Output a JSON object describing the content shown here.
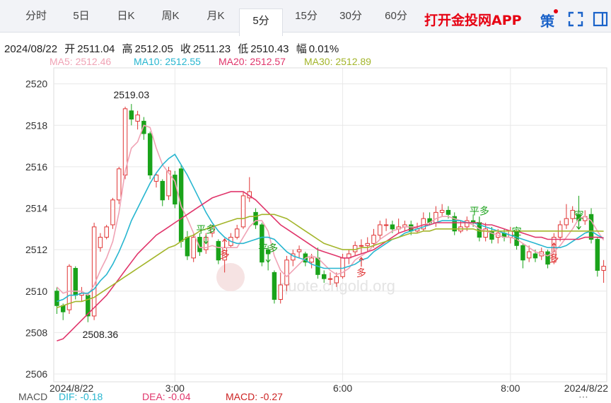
{
  "tabs": [
    {
      "label": "分时",
      "active": false
    },
    {
      "label": "5日",
      "active": false
    },
    {
      "label": "日K",
      "active": false
    },
    {
      "label": "周K",
      "active": false
    },
    {
      "label": "月K",
      "active": false
    },
    {
      "label": "5分",
      "active": true
    },
    {
      "label": "15分",
      "active": false
    },
    {
      "label": "30分",
      "active": false
    },
    {
      "label": "60分",
      "active": false
    }
  ],
  "app_link": "打开金投网APP",
  "strategy_label": "策",
  "icons": {
    "fullscreen": "fullscreen-icon",
    "panel": "panel-icon"
  },
  "quote": {
    "date": "2024/08/22",
    "open_label": "开",
    "open": "2511.04",
    "high_label": "高",
    "high": "2512.05",
    "close_label": "收",
    "close": "2511.23",
    "low_label": "低",
    "low": "2510.43",
    "amp_label": "幅",
    "amp": "0.01%"
  },
  "ma": [
    {
      "text": "MA5: 2512.46",
      "color": "#f0a3b5"
    },
    {
      "text": "MA10: 2512.55",
      "color": "#27b6d0"
    },
    {
      "text": "MA20: 2512.57",
      "color": "#e0356b"
    },
    {
      "text": "MA30: 2512.89",
      "color": "#a3b52a"
    }
  ],
  "macd": {
    "label": "MACD",
    "dif": "DIF: -0.18",
    "dif_color": "#27b6d0",
    "dea": "DEA: -0.04",
    "dea_color": "#e0356b",
    "macd": "MACD: -0.27",
    "macd_color": "#cc2222"
  },
  "watermark": "quote.cngold.org",
  "colors": {
    "up": "#e03535",
    "down": "#1aa31a",
    "grid": "#e8e8e8"
  },
  "chart_data": {
    "type": "candlestick",
    "ylim": [
      2506,
      2520.5
    ],
    "yticks": [
      2506,
      2508,
      2510,
      2512,
      2514,
      2516,
      2518,
      2520
    ],
    "xticks": [
      {
        "label": "2024/8/22",
        "index": 0
      },
      {
        "label": "3:00",
        "index": 19
      },
      {
        "label": "6:00",
        "index": 46
      },
      {
        "label": "8:00",
        "index": 73
      },
      {
        "label": "2024/8/22",
        "index": 88
      }
    ],
    "annotations": [
      {
        "text": "2519.03",
        "index": 12,
        "value": 2519.03,
        "pos": "above"
      },
      {
        "text": "2508.36",
        "index": 7,
        "value": 2508.36,
        "pos": "below"
      }
    ],
    "signals": [
      {
        "text": "平多",
        "index": 24,
        "value": 2512.8,
        "color": "#1aa31a"
      },
      {
        "text": "多",
        "index": 27,
        "value": 2511.6,
        "color": "#e03535"
      },
      {
        "text": "平多",
        "index": 34,
        "value": 2511.9,
        "color": "#1aa31a"
      },
      {
        "text": "多",
        "index": 49,
        "value": 2510.7,
        "color": "#e03535"
      },
      {
        "text": "平多",
        "index": 68,
        "value": 2513.7,
        "color": "#1aa31a"
      },
      {
        "text": "空",
        "index": 74,
        "value": 2512.7,
        "color": "#1aa31a"
      },
      {
        "text": "多",
        "index": 80,
        "value": 2511.4,
        "color": "#e03535"
      },
      {
        "text": "空",
        "index": 84,
        "value": 2513.5,
        "color": "#1aa31a"
      }
    ],
    "candles": [
      [
        2510.0,
        2509.3,
        2510.2,
        2508.9
      ],
      [
        2509.3,
        2509.0,
        2509.4,
        2508.6
      ],
      [
        2509.1,
        2511.2,
        2511.3,
        2508.9
      ],
      [
        2511.1,
        2509.8,
        2511.2,
        2509.6
      ],
      [
        2509.8,
        2509.9,
        2510.2,
        2509.5
      ],
      [
        2509.8,
        2508.8,
        2509.9,
        2508.5
      ],
      [
        2508.8,
        2513.1,
        2513.3,
        2508.6
      ],
      [
        2512.1,
        2512.6,
        2512.8,
        2511.9
      ],
      [
        2512.6,
        2513.1,
        2513.2,
        2512.5
      ],
      [
        2513.2,
        2514.4,
        2514.5,
        2513.0
      ],
      [
        2514.4,
        2515.9,
        2516.0,
        2514.2
      ],
      [
        2515.6,
        2518.8,
        2518.9,
        2515.4
      ],
      [
        2518.7,
        2518.3,
        2519.03,
        2518.0
      ],
      [
        2518.2,
        2518.5,
        2518.7,
        2517.8
      ],
      [
        2518.2,
        2517.6,
        2518.4,
        2517.3
      ],
      [
        2517.6,
        2515.6,
        2517.7,
        2515.4
      ],
      [
        2515.3,
        2515.6,
        2515.7,
        2515.0
      ],
      [
        2515.3,
        2514.4,
        2515.4,
        2514.1
      ],
      [
        2514.6,
        2515.8,
        2516.0,
        2514.4
      ],
      [
        2515.6,
        2514.2,
        2515.8,
        2514.0
      ],
      [
        2515.9,
        2512.4,
        2516.1,
        2512.1
      ],
      [
        2512.6,
        2511.7,
        2512.9,
        2511.5
      ],
      [
        2511.6,
        2512.6,
        2512.8,
        2511.4
      ],
      [
        2512.6,
        2511.9,
        2512.8,
        2511.7
      ],
      [
        2512.0,
        2512.6,
        2512.8,
        2511.8
      ],
      [
        2512.8,
        2513.1,
        2513.2,
        2512.6
      ],
      [
        2512.4,
        2511.5,
        2512.5,
        2511.3
      ],
      [
        2511.5,
        2512.1,
        2512.3,
        2510.9
      ],
      [
        2512.2,
        2512.6,
        2512.8,
        2512.1
      ],
      [
        2512.6,
        2513.0,
        2513.2,
        2512.5
      ],
      [
        2513.1,
        2514.6,
        2514.8,
        2513.0
      ],
      [
        2514.5,
        2514.8,
        2515.5,
        2514.3
      ],
      [
        2513.8,
        2513.2,
        2514.0,
        2513.0
      ],
      [
        2513.2,
        2511.4,
        2513.3,
        2511.2
      ],
      [
        2512.0,
        2511.8,
        2512.2,
        2511.0
      ],
      [
        2510.9,
        2509.6,
        2511.0,
        2509.4
      ],
      [
        2509.6,
        2510.3,
        2510.9,
        2509.4
      ],
      [
        2510.3,
        2511.5,
        2511.7,
        2510.0
      ],
      [
        2511.5,
        2511.8,
        2512.0,
        2511.2
      ],
      [
        2511.9,
        2512.0,
        2512.2,
        2511.6
      ],
      [
        2511.8,
        2511.4,
        2511.9,
        2511.2
      ],
      [
        2511.4,
        2511.6,
        2511.8,
        2511.1
      ],
      [
        2511.6,
        2510.8,
        2512.1,
        2510.6
      ],
      [
        2510.8,
        2510.6,
        2511.0,
        2510.4
      ],
      [
        2510.6,
        2510.6,
        2510.9,
        2510.3
      ],
      [
        2510.4,
        2510.7,
        2510.9,
        2510.2
      ],
      [
        2510.7,
        2511.6,
        2511.8,
        2510.6
      ],
      [
        2511.6,
        2511.8,
        2512.0,
        2511.3
      ],
      [
        2511.9,
        2512.2,
        2512.4,
        2511.7
      ],
      [
        2512.2,
        2512.2,
        2512.5,
        2511.8
      ],
      [
        2512.2,
        2512.3,
        2512.6,
        2511.9
      ],
      [
        2512.3,
        2512.7,
        2513.0,
        2512.1
      ],
      [
        2512.7,
        2513.2,
        2513.4,
        2512.5
      ],
      [
        2513.2,
        2513.2,
        2513.5,
        2512.9
      ],
      [
        2513.2,
        2513.0,
        2513.4,
        2512.8
      ],
      [
        2513.0,
        2513.1,
        2513.5,
        2512.8
      ],
      [
        2513.1,
        2513.2,
        2513.4,
        2512.9
      ],
      [
        2513.2,
        2512.9,
        2513.4,
        2512.7
      ],
      [
        2512.9,
        2513.0,
        2513.3,
        2512.8
      ],
      [
        2513.0,
        2513.5,
        2513.8,
        2512.9
      ],
      [
        2513.5,
        2513.3,
        2513.8,
        2513.2
      ],
      [
        2513.3,
        2513.8,
        2514.1,
        2513.1
      ],
      [
        2513.8,
        2513.9,
        2514.2,
        2513.6
      ],
      [
        2513.9,
        2513.7,
        2514.1,
        2513.5
      ],
      [
        2513.6,
        2512.9,
        2513.8,
        2512.7
      ],
      [
        2512.9,
        2513.1,
        2513.4,
        2512.8
      ],
      [
        2513.1,
        2513.4,
        2513.6,
        2512.9
      ],
      [
        2513.4,
        2513.3,
        2513.7,
        2513.1
      ],
      [
        2513.3,
        2512.6,
        2513.4,
        2512.4
      ],
      [
        2512.6,
        2513.0,
        2513.3,
        2512.4
      ],
      [
        2512.9,
        2512.5,
        2513.1,
        2512.3
      ],
      [
        2512.6,
        2512.8,
        2513.0,
        2512.3
      ],
      [
        2512.8,
        2512.6,
        2513.0,
        2512.4
      ],
      [
        2512.6,
        2512.9,
        2513.1,
        2512.3
      ],
      [
        2512.9,
        2512.2,
        2513.0,
        2512.0
      ],
      [
        2512.2,
        2511.5,
        2512.3,
        2511.1
      ],
      [
        2511.6,
        2511.9,
        2512.2,
        2511.4
      ],
      [
        2511.8,
        2511.6,
        2512.0,
        2511.4
      ],
      [
        2511.7,
        2511.9,
        2512.1,
        2511.5
      ],
      [
        2511.9,
        2511.3,
        2512.0,
        2511.1
      ],
      [
        2511.4,
        2512.6,
        2512.8,
        2511.3
      ],
      [
        2512.6,
        2513.2,
        2513.4,
        2512.4
      ],
      [
        2513.2,
        2513.5,
        2514.2,
        2513.0
      ],
      [
        2513.5,
        2513.9,
        2514.1,
        2513.3
      ],
      [
        2513.7,
        2513.4,
        2514.6,
        2513.2
      ],
      [
        2513.4,
        2513.6,
        2513.9,
        2513.2
      ],
      [
        2513.7,
        2512.5,
        2514.0,
        2512.3
      ],
      [
        2512.5,
        2511.0,
        2512.6,
        2510.7
      ],
      [
        2511.0,
        2511.2,
        2511.5,
        2510.4
      ]
    ],
    "ma_series": [
      {
        "name": "MA5",
        "color": "#f0a3b5",
        "values": [
          2510.2,
          2509.9,
          2510.0,
          2510.0,
          2510.0,
          2509.8,
          2510.3,
          2511.0,
          2511.6,
          2512.4,
          2513.8,
          2515.8,
          2516.9,
          2517.2,
          2518.0,
          2517.9,
          2516.9,
          2516.1,
          2515.7,
          2515.3,
          2514.1,
          2513.5,
          2512.8,
          2512.1,
          2512.1,
          2512.2,
          2512.1,
          2512.1,
          2512.1,
          2512.1,
          2512.6,
          2513.1,
          2513.4,
          2513.4,
          2512.9,
          2511.7,
          2511.0,
          2510.7,
          2511.0,
          2511.3,
          2511.6,
          2511.7,
          2511.6,
          2511.3,
          2511.0,
          2510.8,
          2510.9,
          2511.1,
          2511.5,
          2511.7,
          2511.9,
          2512.2,
          2512.5,
          2512.7,
          2512.9,
          2513.0,
          2513.1,
          2513.1,
          2513.1,
          2513.2,
          2513.3,
          2513.5,
          2513.6,
          2513.6,
          2513.5,
          2513.4,
          2513.3,
          2513.2,
          2513.0,
          2512.9,
          2512.8,
          2512.7,
          2512.6,
          2512.6,
          2512.5,
          2512.3,
          2512.1,
          2511.9,
          2511.8,
          2511.7,
          2511.9,
          2512.2,
          2512.6,
          2513.0,
          2513.5,
          2513.6,
          2513.4,
          2512.9,
          2512.46
        ]
      },
      {
        "name": "MA10",
        "color": "#27b6d0",
        "values": [
          2509.5,
          2509.6,
          2509.8,
          2509.8,
          2509.9,
          2509.9,
          2510.1,
          2510.5,
          2510.8,
          2511.3,
          2511.9,
          2512.6,
          2513.4,
          2514.0,
          2514.6,
          2515.2,
          2515.7,
          2516.1,
          2516.4,
          2516.6,
          2516.1,
          2515.6,
          2515.0,
          2514.4,
          2513.8,
          2513.3,
          2512.9,
          2512.6,
          2512.4,
          2512.3,
          2512.3,
          2512.4,
          2512.5,
          2512.6,
          2512.6,
          2512.5,
          2512.2,
          2511.9,
          2511.7,
          2511.6,
          2511.5,
          2511.3,
          2511.2,
          2511.1,
          2511.1,
          2511.1,
          2511.1,
          2511.2,
          2511.3,
          2511.5,
          2511.6,
          2511.9,
          2512.1,
          2512.3,
          2512.5,
          2512.6,
          2512.8,
          2512.9,
          2513.0,
          2513.1,
          2513.2,
          2513.3,
          2513.4,
          2513.4,
          2513.4,
          2513.4,
          2513.3,
          2513.3,
          2513.2,
          2513.1,
          2513.0,
          2512.9,
          2512.8,
          2512.7,
          2512.6,
          2512.5,
          2512.4,
          2512.3,
          2512.2,
          2512.1,
          2512.1,
          2512.1,
          2512.2,
          2512.4,
          2512.6,
          2512.8,
          2512.9,
          2512.7,
          2512.55
        ]
      },
      {
        "name": "MA20",
        "color": "#e0356b",
        "values": [
          2507.6,
          2507.7,
          2508.0,
          2508.3,
          2508.6,
          2508.9,
          2509.2,
          2509.5,
          2509.8,
          2510.2,
          2510.6,
          2511.0,
          2511.4,
          2511.8,
          2512.1,
          2512.4,
          2512.7,
          2512.9,
          2513.1,
          2513.3,
          2513.5,
          2513.7,
          2513.9,
          2514.1,
          2514.3,
          2514.5,
          2514.6,
          2514.7,
          2514.8,
          2514.8,
          2514.8,
          2514.6,
          2514.4,
          2514.1,
          2513.8,
          2513.5,
          2513.2,
          2513.0,
          2512.8,
          2512.6,
          2512.4,
          2512.2,
          2512.0,
          2511.9,
          2511.8,
          2511.7,
          2511.6,
          2511.6,
          2511.7,
          2511.8,
          2511.9,
          2512.0,
          2512.2,
          2512.4,
          2512.6,
          2512.8,
          2512.9,
          2513.0,
          2513.1,
          2513.2,
          2513.2,
          2513.3,
          2513.3,
          2513.3,
          2513.3,
          2513.3,
          2513.3,
          2513.3,
          2513.3,
          2513.2,
          2513.2,
          2513.1,
          2513.0,
          2512.9,
          2512.9,
          2512.8,
          2512.7,
          2512.6,
          2512.6,
          2512.5,
          2512.5,
          2512.5,
          2512.5,
          2512.5,
          2512.5,
          2512.6,
          2512.6,
          2512.6,
          2512.57
        ]
      },
      {
        "name": "MA30",
        "color": "#a3b52a",
        "values": [
          2509.2,
          2509.3,
          2509.4,
          2509.5,
          2509.5,
          2509.6,
          2509.7,
          2509.9,
          2510.1,
          2510.3,
          2510.5,
          2510.7,
          2510.9,
          2511.1,
          2511.3,
          2511.5,
          2511.7,
          2511.9,
          2512.1,
          2512.2,
          2512.4,
          2512.6,
          2512.7,
          2512.9,
          2513.0,
          2513.1,
          2513.2,
          2513.3,
          2513.4,
          2513.5,
          2513.5,
          2513.6,
          2513.6,
          2513.7,
          2513.7,
          2513.7,
          2513.6,
          2513.5,
          2513.3,
          2513.1,
          2512.9,
          2512.7,
          2512.5,
          2512.3,
          2512.2,
          2512.1,
          2512.0,
          2512.0,
          2512.0,
          2512.1,
          2512.1,
          2512.2,
          2512.3,
          2512.4,
          2512.5,
          2512.6,
          2512.7,
          2512.8,
          2512.8,
          2512.9,
          2512.9,
          2513.0,
          2513.0,
          2513.0,
          2513.0,
          2513.0,
          2513.0,
          2513.0,
          2512.9,
          2512.9,
          2512.9,
          2512.9,
          2512.9,
          2512.9,
          2512.9,
          2512.9,
          2512.9,
          2512.9,
          2512.9,
          2512.9,
          2512.9,
          2512.9,
          2512.9,
          2512.9,
          2512.9,
          2512.9,
          2512.9,
          2512.9,
          2512.89
        ]
      }
    ]
  }
}
